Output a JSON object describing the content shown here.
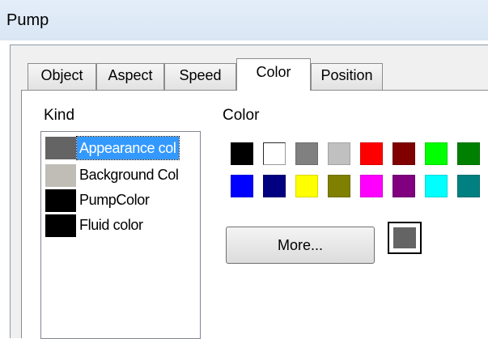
{
  "window": {
    "title": "Pump"
  },
  "tabs": [
    {
      "label": "Object"
    },
    {
      "label": "Aspect"
    },
    {
      "label": "Speed"
    },
    {
      "label": "Color",
      "active": true
    },
    {
      "label": "Position"
    }
  ],
  "kind": {
    "label": "Kind",
    "items": [
      {
        "label": "Appearance col",
        "swatch": "#646464",
        "selected": true
      },
      {
        "label": "Background Col",
        "swatch": "#c0bdb6"
      },
      {
        "label": "PumpColor",
        "swatch": "#000000"
      },
      {
        "label": "Fluid color",
        "swatch": "#000000"
      }
    ]
  },
  "color": {
    "label": "Color",
    "palette": [
      [
        "#000000",
        "#ffffff",
        "#808080",
        "#c0c0c0",
        "#ff0000",
        "#800000",
        "#00ff00",
        "#008000"
      ],
      [
        "#0000ff",
        "#000080",
        "#ffff00",
        "#808000",
        "#ff00ff",
        "#800080",
        "#00ffff",
        "#008080"
      ]
    ],
    "more_label": "More...",
    "current": "#646464"
  }
}
